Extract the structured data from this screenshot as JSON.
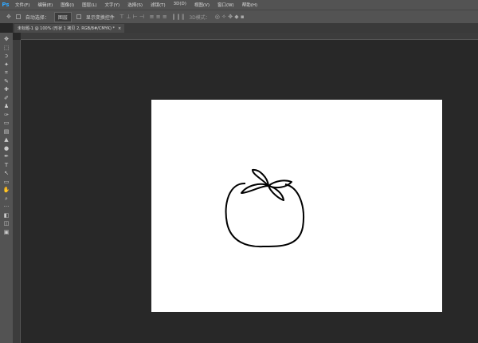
{
  "app": {
    "logo": "Ps"
  },
  "menu": [
    "文件(F)",
    "编辑(E)",
    "图像(I)",
    "图层(L)",
    "文字(Y)",
    "选择(S)",
    "滤镜(T)",
    "3D(D)",
    "视图(V)",
    "窗口(W)",
    "帮助(H)"
  ],
  "options": {
    "auto_select_label": "自动选择：",
    "auto_select_value": "图层",
    "show_transform_label": "显示变换控件",
    "mode_3d": "3D模式："
  },
  "document_tab": {
    "title": "未标题-1 @ 100% (形状 1 拷贝 2, RGB/8#/CMYK) *",
    "close": "×"
  },
  "tools": [
    "move",
    "marquee",
    "lasso",
    "magic-wand",
    "crop",
    "eyedropper",
    "healing",
    "brush",
    "stamp",
    "history-brush",
    "eraser",
    "gradient",
    "blur",
    "dodge",
    "pen",
    "type",
    "path-select",
    "shape",
    "hand",
    "zoom",
    "more",
    "colors",
    "quick-mask",
    "screen-mode"
  ],
  "colors": {
    "canvas": "#ffffff",
    "workspace": "#282828",
    "panel": "#535353",
    "stroke": "#000000"
  }
}
